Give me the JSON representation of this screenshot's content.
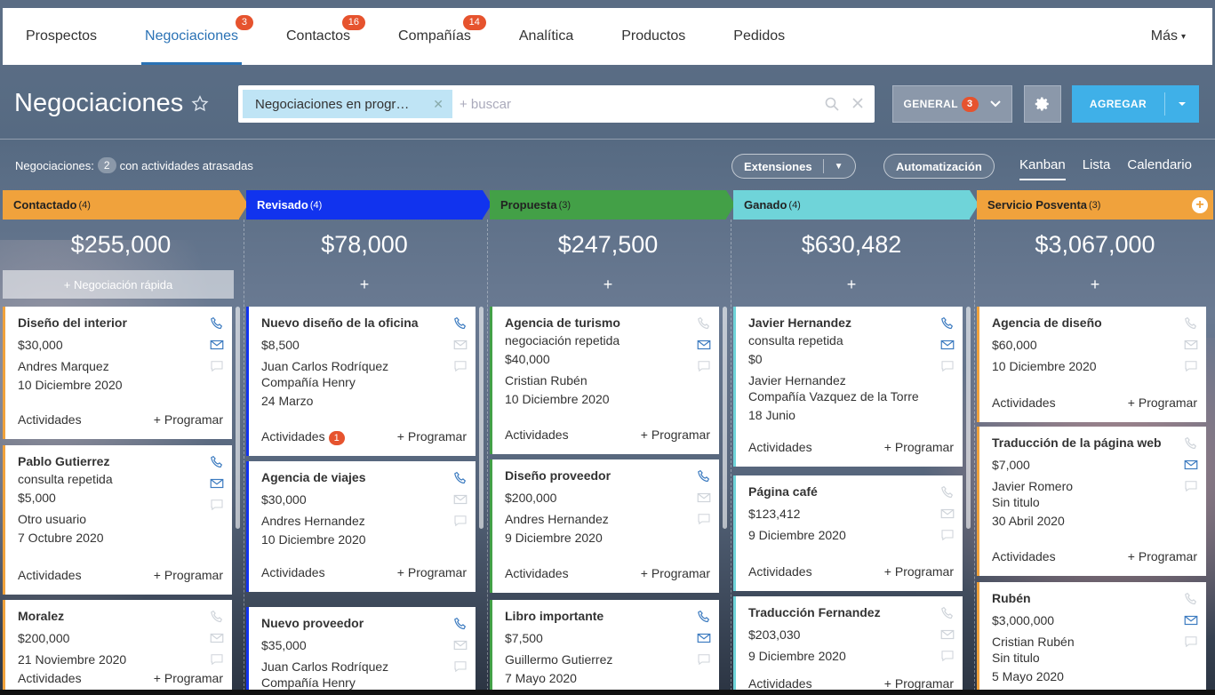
{
  "nav": {
    "items": [
      {
        "label": "Prospectos",
        "badge": ""
      },
      {
        "label": "Negociaciones",
        "badge": "3"
      },
      {
        "label": "Contactos",
        "badge": "16"
      },
      {
        "label": "Compañías",
        "badge": "14"
      },
      {
        "label": "Analítica",
        "badge": ""
      },
      {
        "label": "Productos",
        "badge": ""
      },
      {
        "label": "Pedidos",
        "badge": ""
      }
    ],
    "more": "Más"
  },
  "header": {
    "title": "Negociaciones",
    "filter_chip": "Negociaciones en progr…",
    "search_placeholder": "+ buscar",
    "general_label": "GENERAL",
    "general_badge": "3",
    "add_label": "AGREGAR"
  },
  "toolbar": {
    "prefix": "Negociaciones:",
    "overdue_count": "2",
    "suffix": "con actividades atrasadas",
    "extensions": "Extensiones",
    "automation": "Automatización",
    "views": [
      "Kanban",
      "Lista",
      "Calendario"
    ]
  },
  "columns": [
    {
      "name": "Contactado",
      "count": "(4)",
      "color": "#f0a23c",
      "total": "$255,000",
      "quick": "+ Negociación rápida",
      "cards": [
        {
          "title": "Diseño del interior",
          "sub": "",
          "amount": "$30,000",
          "links": [
            "Andres Marquez"
          ],
          "date": "10 Diciembre 2020",
          "act_badge": ""
        },
        {
          "title": "Pablo Gutierrez",
          "sub": "consulta repetida",
          "amount": "$5,000",
          "links": [
            "Otro usuario"
          ],
          "date": "7 Octubre 2020",
          "act_badge": ""
        },
        {
          "title": "Moralez",
          "sub": "",
          "amount": "$200,000",
          "links": [],
          "date": "21 Noviembre 2020",
          "act_badge": ""
        }
      ]
    },
    {
      "name": "Revisado",
      "count": "(4)",
      "color": "#1133ee",
      "total": "$78,000",
      "quick": "",
      "cards": [
        {
          "title": "Nuevo diseño de la oficina",
          "sub": "",
          "amount": "$8,500",
          "links": [
            "Juan Carlos Rodríquez",
            "Compañía Henry"
          ],
          "date": "24 Marzo",
          "act_badge": "1"
        },
        {
          "title": "Agencia de viajes",
          "sub": "",
          "amount": "$30,000",
          "links": [
            "Andres Hernandez"
          ],
          "date": "10 Diciembre 2020",
          "act_badge": ""
        },
        {
          "title": "Nuevo proveedor",
          "sub": "",
          "amount": "$35,000",
          "links": [
            "Juan Carlos Rodríquez",
            "Compañía Henry"
          ],
          "date": "",
          "act_badge": ""
        }
      ]
    },
    {
      "name": "Propuesta",
      "count": "(3)",
      "color": "#43a047",
      "total": "$247,500",
      "quick": "",
      "cards": [
        {
          "title": "Agencia de turismo",
          "sub": "negociación repetida",
          "amount": "$40,000",
          "links": [
            "Cristian Rubén"
          ],
          "date": "10 Diciembre 2020",
          "act_badge": ""
        },
        {
          "title": "Diseño proveedor",
          "sub": "",
          "amount": "$200,000",
          "links": [
            "Andres Hernandez"
          ],
          "date": "9 Diciembre 2020",
          "act_badge": ""
        },
        {
          "title": "Libro importante",
          "sub": "",
          "amount": "$7,500",
          "links": [
            "Guillermo Gutierrez"
          ],
          "date": "7 Mayo 2020",
          "act_badge": ""
        }
      ]
    },
    {
      "name": "Ganado",
      "count": "(4)",
      "color": "#6fd4d9",
      "total": "$630,482",
      "quick": "",
      "cards": [
        {
          "title": "Javier Hernandez",
          "sub": "consulta repetida",
          "amount": "$0",
          "links": [
            "Javier Hernandez",
            "Compañía Vazquez de la Torre"
          ],
          "date": "18 Junio",
          "act_badge": ""
        },
        {
          "title": "Página café",
          "sub": "",
          "amount": "$123,412",
          "links": [],
          "date": "9 Diciembre 2020",
          "act_badge": ""
        },
        {
          "title": "Traducción Fernandez",
          "sub": "",
          "amount": "$203,030",
          "links": [],
          "date": "9 Diciembre 2020",
          "act_badge": ""
        }
      ]
    },
    {
      "name": "Servicio Posventa",
      "count": "(3)",
      "color": "#f0a23c",
      "total": "$3,067,000",
      "quick": "",
      "cards": [
        {
          "title": "Agencia de diseño",
          "sub": "",
          "amount": "$60,000",
          "links": [],
          "date": "10 Diciembre 2020",
          "act_badge": ""
        },
        {
          "title": "Traducción de la página web",
          "sub": "",
          "amount": "$7,000",
          "links": [
            "Javier Romero",
            "Sin titulo"
          ],
          "date": "30 Abril 2020",
          "act_badge": ""
        },
        {
          "title": "Rubén",
          "sub": "",
          "amount": "$3,000,000",
          "links": [
            "Cristian Rubén",
            "Sin titulo"
          ],
          "date": "5 Mayo 2020",
          "act_badge": ""
        }
      ]
    }
  ],
  "card_labels": {
    "activities": "Actividades",
    "schedule": "+ Programar"
  },
  "colors": {
    "accent": "#2a72b5",
    "badge": "#e6532e",
    "add_button": "#3fb0e8"
  }
}
